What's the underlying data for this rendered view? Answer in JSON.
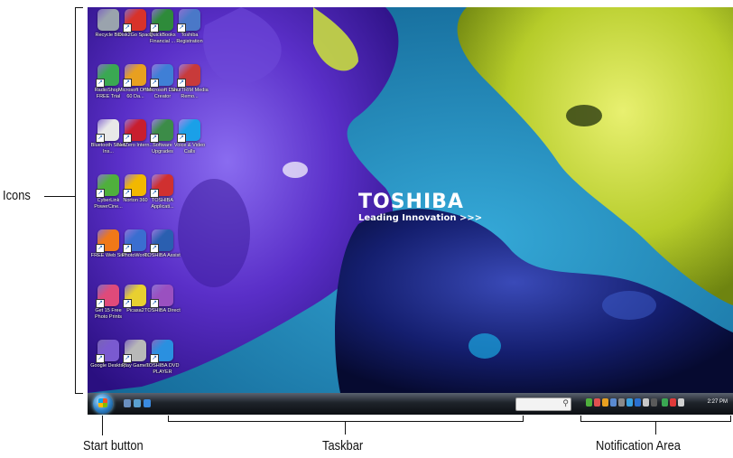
{
  "callouts": {
    "icons": "Icons",
    "start_button": "Start button",
    "taskbar": "Taskbar",
    "notification_area": "Notification Area"
  },
  "desktop": {
    "brand_name": "TOSHIBA",
    "brand_tagline": "Leading Innovation >>>",
    "icons": [
      {
        "label": "Recycle Bin",
        "color": "#9aa3ad"
      },
      {
        "label": "Disk2Go Space",
        "color": "#d8322a"
      },
      {
        "label": "QuickBooks Financial ...",
        "color": "#2e8b3a"
      },
      {
        "label": "Toshiba Registration",
        "color": "#4a78c8"
      },
      {
        "label": "RadioShop - FREE Trial",
        "color": "#3aa852"
      },
      {
        "label": "Microsoft Office 60 Da...",
        "color": "#e8a020"
      },
      {
        "label": "Microsoft Disc Creator",
        "color": "#3f7fd6"
      },
      {
        "label": "ShutTRIM Media Remo...",
        "color": "#c83a3a"
      },
      {
        "label": "Bluetooth Stack Ins...",
        "color": "#e8e8e8"
      },
      {
        "label": "NetZero Intern...",
        "color": "#c81e2e"
      },
      {
        "label": "Software Upgrades",
        "color": "#3c8c48"
      },
      {
        "label": "Voice & Video Calls",
        "color": "#1aa0e8"
      },
      {
        "label": "CyberLink PowerCine...",
        "color": "#4fb03c"
      },
      {
        "label": "Norton 360",
        "color": "#f2b800"
      },
      {
        "label": "TOSHIBA Applicati...",
        "color": "#d03030"
      },
      {
        "label": "",
        "color": ""
      },
      {
        "label": "FREE Web Site",
        "color": "#f07818"
      },
      {
        "label": "PhotoWorks",
        "color": "#3a6ed0"
      },
      {
        "label": "TOSHIBA Assist",
        "color": "#2a5fb0"
      },
      {
        "label": "",
        "color": ""
      },
      {
        "label": "Get 15 Free Photo Prints",
        "color": "#e04a7a"
      },
      {
        "label": "Picasa2",
        "color": "#e8d030"
      },
      {
        "label": "TOSHIBA Direct",
        "color": "#9a50c0"
      },
      {
        "label": "",
        "color": ""
      },
      {
        "label": "Google Desktop",
        "color": "#7a5ad0"
      },
      {
        "label": "Play Games",
        "color": "#b8b8b8"
      },
      {
        "label": "TOSHIBA DVD PLAYER",
        "color": "#2a90e0"
      }
    ]
  },
  "taskbar": {
    "clock": "2:27 PM"
  }
}
